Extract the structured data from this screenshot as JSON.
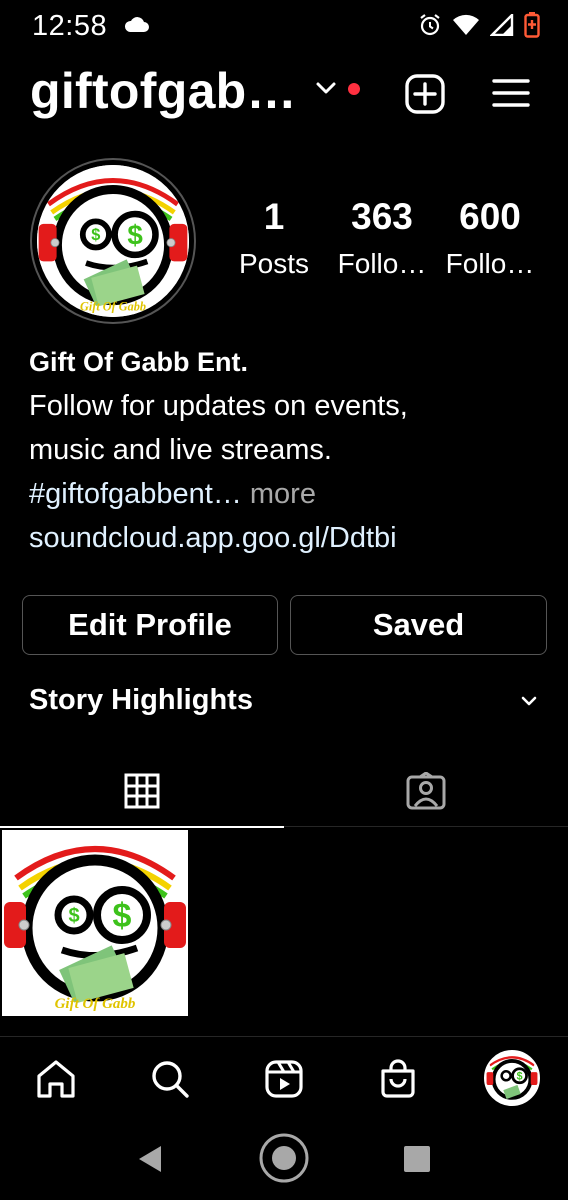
{
  "status_bar": {
    "time": "12:58"
  },
  "header": {
    "username": "giftofgab…"
  },
  "profile": {
    "stats": [
      {
        "value": "1",
        "label": "Posts"
      },
      {
        "value": "363",
        "label": "Follo…"
      },
      {
        "value": "600",
        "label": "Follo…"
      }
    ],
    "bio": {
      "name": "Gift Of Gabb Ent.",
      "line1": "Follow for updates on events,",
      "line2": "music and live streams.",
      "hashtag": "#giftofgabbent…",
      "more": " more",
      "link": "soundcloud.app.goo.gl/Ddtbi"
    }
  },
  "actions": {
    "edit_profile": "Edit Profile",
    "saved": "Saved"
  },
  "highlights": {
    "title": "Story Highlights"
  },
  "logo": {
    "text": "Gift  Of  Gabb"
  },
  "colors": {
    "background": "#000000",
    "notification_dot": "#ff3040",
    "link": "#e0f1ff",
    "muted": "#a8a8a8",
    "border": "#555555",
    "logo_green": "#3dc21b",
    "logo_red": "#e31b1b",
    "logo_yellow": "#f4d200",
    "battery": "#ff5a36"
  }
}
